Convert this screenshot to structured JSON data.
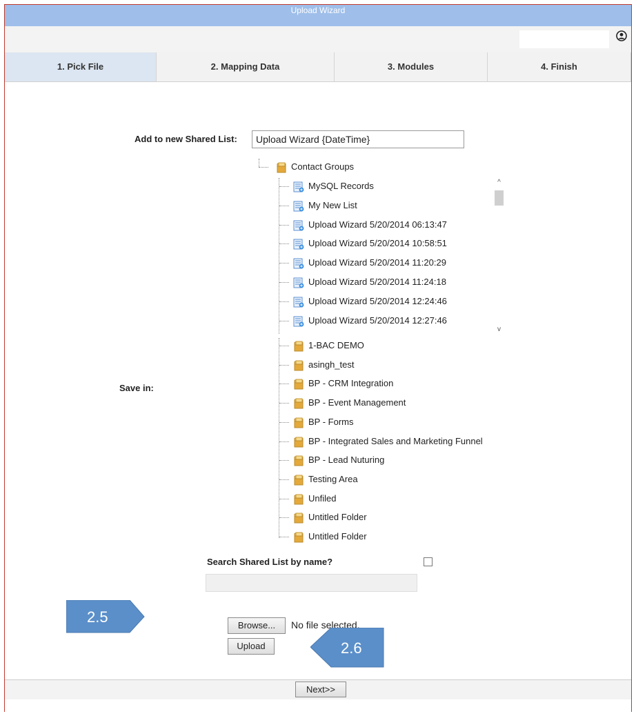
{
  "window": {
    "title": "Upload Wizard"
  },
  "tabs": [
    {
      "label": "1. Pick File",
      "active": true
    },
    {
      "label": "2. Mapping Data",
      "active": false
    },
    {
      "label": "3. Modules",
      "active": false
    },
    {
      "label": "4. Finish",
      "active": false
    }
  ],
  "form": {
    "shared_list_label": "Add to new Shared List:",
    "shared_list_value": "Upload Wizard {DateTime}",
    "save_in_label": "Save in:",
    "search_label": "Search Shared List by name?",
    "search_checked": false,
    "search_value": ""
  },
  "tree": {
    "root": "Contact Groups",
    "lists": [
      "MySQL Records",
      "My New List",
      "Upload Wizard 5/20/2014 06:13:47",
      "Upload Wizard 5/20/2014 10:58:51",
      "Upload Wizard 5/20/2014 11:20:29",
      "Upload Wizard 5/20/2014 11:24:18",
      "Upload Wizard 5/20/2014 12:24:46",
      "Upload Wizard 5/20/2014 12:27:46"
    ],
    "folders": [
      "1-BAC DEMO",
      "asingh_test",
      "BP - CRM Integration",
      "BP - Event Management",
      "BP - Forms",
      "BP - Integrated Sales and Marketing Funnel",
      "BP - Lead Nuturing",
      "Testing Area",
      "Unfiled",
      "Untitled Folder",
      "Untitled Folder"
    ]
  },
  "file": {
    "browse_label": "Browse...",
    "status": "No file selected.",
    "upload_label": "Upload"
  },
  "footer": {
    "next_label": "Next>>"
  },
  "callouts": {
    "left": "2.5",
    "right": "2.6"
  },
  "colors": {
    "titlebar": "#9fbfea",
    "active_tab": "#dce6f2",
    "callout": "#5b8fc9",
    "frame": "#c0392b"
  }
}
